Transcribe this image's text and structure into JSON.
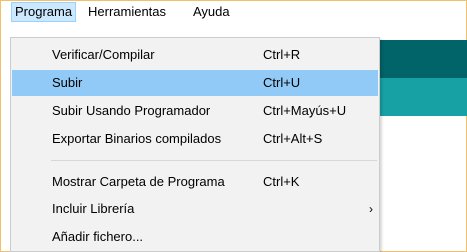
{
  "menubar": {
    "items": [
      {
        "label": "Programa",
        "active": true
      },
      {
        "label": "Herramientas",
        "active": false
      },
      {
        "label": "Ayuda",
        "active": false
      }
    ]
  },
  "colors": {
    "menubar_active_bg": "#cce8ff",
    "highlight_bg": "#91c9f7",
    "menu_bg": "#f2f2f2",
    "teal_dark": "#006468",
    "teal_light": "#17a1a5",
    "frame_border": "#f2bf6a"
  },
  "dropdown": {
    "items": [
      {
        "label": "Verificar/Compilar",
        "shortcut": "Ctrl+R",
        "highlighted": false
      },
      {
        "label": "Subir",
        "shortcut": "Ctrl+U",
        "highlighted": true
      },
      {
        "label": "Subir Usando Programador",
        "shortcut": "Ctrl+Mayús+U",
        "highlighted": false
      },
      {
        "label": "Exportar Binarios compilados",
        "shortcut": "Ctrl+Alt+S",
        "highlighted": false
      },
      {
        "label": "Mostrar Carpeta de Programa",
        "shortcut": "Ctrl+K",
        "highlighted": false
      },
      {
        "label": "Incluir Librería",
        "shortcut": "",
        "submenu_icon": "chevron-right-icon",
        "highlighted": false
      },
      {
        "label": "Añadir fichero...",
        "shortcut": "",
        "highlighted": false
      }
    ]
  }
}
